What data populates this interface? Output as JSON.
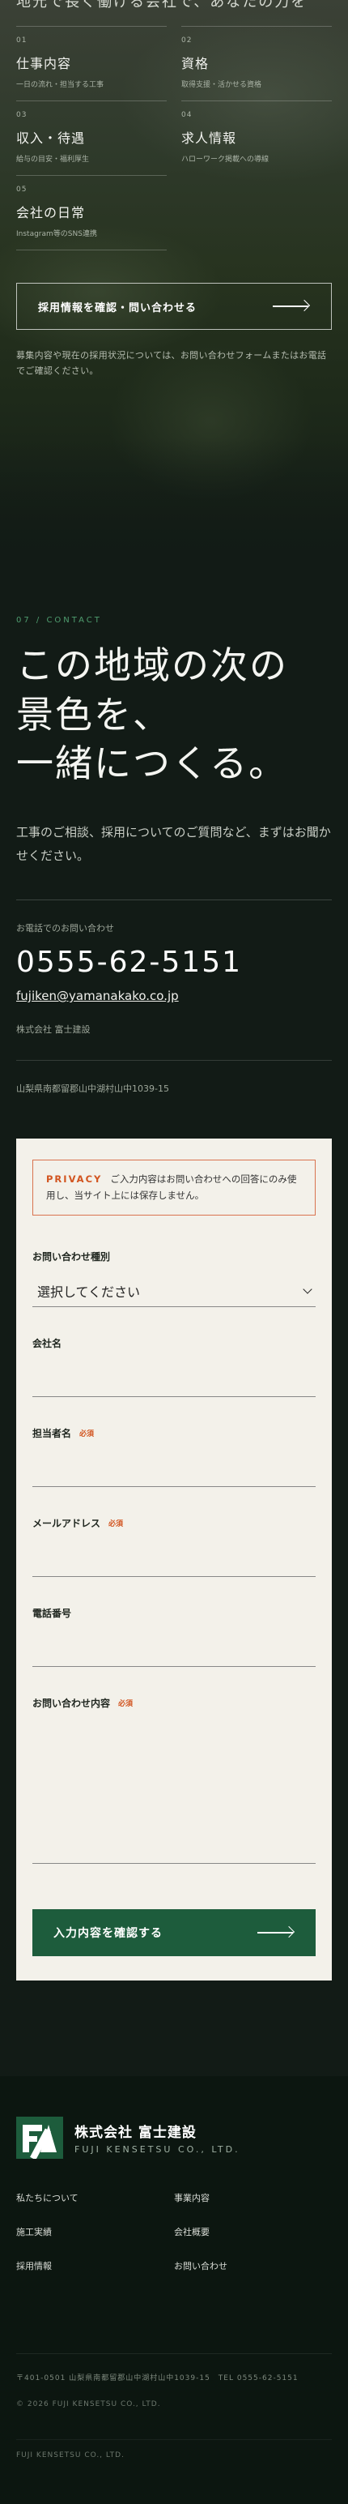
{
  "recruit": {
    "heading_fragment": "地元で長く働ける会社で、あなたの力を",
    "cards": [
      {
        "num": "01",
        "title": "仕事内容",
        "sub": "一日の流れ・担当する工事"
      },
      {
        "num": "02",
        "title": "資格",
        "sub": "取得支援・活かせる資格"
      },
      {
        "num": "03",
        "title": "収入・待遇",
        "sub": "給与の目安・福利厚生"
      },
      {
        "num": "04",
        "title": "求人情報",
        "sub": "ハローワーク掲載への導線"
      },
      {
        "num": "05",
        "title": "会社の日常",
        "sub": "Instagram等のSNS連携"
      }
    ],
    "cta_label": "採用情報を確認・問い合わせる",
    "note": "募集内容や現在の採用状況については、お問い合わせフォームまたはお電話でご確認ください。"
  },
  "contact": {
    "eyebrow": "07 / CONTACT",
    "headline_1": "この地域の次の",
    "headline_2": "景色を、",
    "headline_3": "一緒につくる。",
    "lead": "工事のご相談、採用についてのご質問など、まずはお聞かせください。",
    "tel_caption": "お電話でのお問い合わせ",
    "tel": "0555-62-5151",
    "email": "fujiken@yamanakako.co.jp",
    "company": "株式会社 富士建設",
    "address": "山梨県南都留郡山中湖村山中1039-15"
  },
  "form": {
    "privacy_label": "PRIVACY",
    "privacy_text": "ご入力内容はお問い合わせへの回答にのみ使用し、当サイト上には保存しません。",
    "type_label": "お問い合わせ種別",
    "type_selected": "選択してください",
    "company_label": "会社名",
    "name_label": "担当者名",
    "email_label": "メールアドレス",
    "phone_label": "電話番号",
    "message_label": "お問い合わせ内容",
    "required": "必須",
    "submit_label": "入力内容を確認する"
  },
  "footer": {
    "company_jp": "株式会社 富士建設",
    "company_en": "FUJI KENSETSU CO., LTD.",
    "nav": [
      "私たちについて",
      "事業内容",
      "施工実績",
      "会社概要",
      "採用情報",
      "お問い合わせ"
    ],
    "info": "〒401-0501 山梨県南都留郡山中湖村山中1039-15　TEL 0555-62-5151",
    "copyright": "© 2026 FUJI KENSETSU CO., LTD.",
    "bottom": "FUJI KENSETSU CO., LTD."
  },
  "colors": {
    "background": "#121b16",
    "accent_green": "#1d5c3c",
    "required_orange": "#d2541f",
    "form_background": "#f3f1ea"
  }
}
